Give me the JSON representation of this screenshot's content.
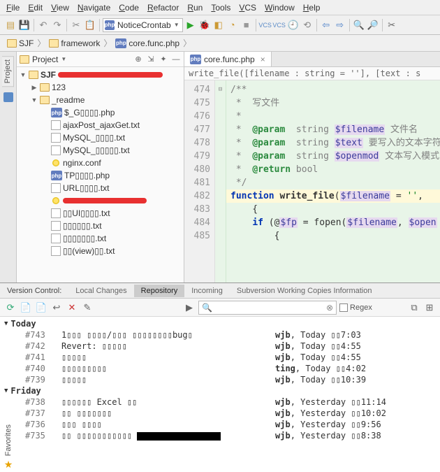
{
  "menu": [
    "File",
    "Edit",
    "View",
    "Navigate",
    "Code",
    "Refactor",
    "Run",
    "Tools",
    "VCS",
    "Window",
    "Help"
  ],
  "runConfig": "NoticeCrontab",
  "crumbs": {
    "root": "SJF",
    "mid": "framework",
    "file": "core.func.php"
  },
  "project": {
    "title": "Project",
    "root": "SJF",
    "sub1": "123",
    "sub2": "_readme",
    "files": [
      "$_G▯▯▯▯.php",
      "ajaxPost_ajaxGet.txt",
      "MySQL_▯▯▯▯.txt",
      "MySQL_▯▯▯▯▯.txt",
      "nginx.conf",
      "TP▯▯▯▯.php",
      "URL▯▯▯▯.txt",
      "",
      "▯▯UI▯▯▯▯.txt",
      "▯▯▯▯▯▯.txt",
      "▯▯▯▯▯▯▯.txt",
      "▯▯(view)▯▯.txt"
    ]
  },
  "editor": {
    "tab": "core.func.php",
    "fnsig": "write_file([filename : string = ''], [text : s",
    "startLine": 474,
    "lines": [
      {
        "t": "/**",
        "cls": "c-gray"
      },
      {
        "t": " *  写文件",
        "cls": "c-gray"
      },
      {
        "t": " *",
        "cls": "c-gray"
      },
      {
        "t": " *  @param  string $filename 文件名",
        "param": true,
        "var": "$filename",
        "after": "文件名"
      },
      {
        "t": " *  @param  string $text 要写入的文本字符",
        "param": true,
        "var": "$text",
        "after": "要写入的文本字符"
      },
      {
        "t": " *  @param  string $openmod 文本写入模式",
        "param": true,
        "var": "$openmod",
        "after": "文本写入模式"
      },
      {
        "t": " *  @return bool",
        "return": true
      },
      {
        "t": " */",
        "cls": "c-gray"
      },
      {
        "fun": true
      },
      {
        "t": "{",
        "cls": "",
        "ind": 1
      },
      {
        "body": true
      },
      {
        "t": "{",
        "cls": "",
        "ind": 2
      }
    ]
  },
  "vcs": {
    "panelTitle": "Version Control:",
    "tabs": [
      "Local Changes",
      "Repository",
      "Incoming",
      "Subversion Working Copies Information"
    ],
    "activeTab": 1,
    "regexLabel": "Regex",
    "groups": [
      {
        "label": "Today",
        "rows": [
          {
            "rev": "#743",
            "msg": "1▯▯▯ ▯▯▯▯/▯▯▯ ▯▯▯▯▯▯▯▯bug▯",
            "who": "wjb",
            "when": "Today ▯▯7:03"
          },
          {
            "rev": "#742",
            "msg": "Revert: ▯▯▯▯▯",
            "who": "wjb",
            "when": "Today ▯▯4:55"
          },
          {
            "rev": "#741",
            "msg": "▯▯▯▯▯",
            "who": "wjb",
            "when": "Today ▯▯4:55"
          },
          {
            "rev": "#740",
            "msg": "▯▯▯▯▯▯▯▯▯",
            "who": "ting",
            "when": "Today ▯▯4:02"
          },
          {
            "rev": "#739",
            "msg": "▯▯▯▯▯",
            "who": "wjb",
            "when": "Today ▯▯10:39"
          }
        ]
      },
      {
        "label": "Friday",
        "rows": [
          {
            "rev": "#738",
            "msg": "▯▯▯▯▯▯ Excel ▯▯",
            "who": "wjb",
            "when": "Yesterday ▯▯11:14"
          },
          {
            "rev": "#737",
            "msg": "▯▯ ▯▯▯▯▯▯▯",
            "who": "wjb",
            "when": "Yesterday ▯▯10:02"
          },
          {
            "rev": "#736",
            "msg": "▯▯▯ ▯▯▯▯",
            "who": "wjb",
            "when": "Yesterday ▯▯9:56"
          },
          {
            "rev": "#735",
            "msg": "▯▯ ▯▯▯▯▯▯▯▯▯▯▯",
            "who": "wjb",
            "when": "Yesterday ▯▯8:38",
            "black": true
          }
        ]
      }
    ]
  },
  "favorites": "Favorites"
}
